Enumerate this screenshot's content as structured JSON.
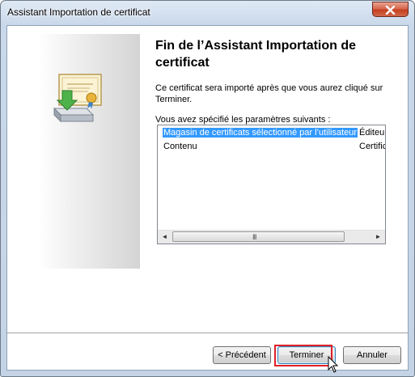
{
  "window": {
    "title": "Assistant Importation de certificat",
    "close_icon": "close-icon"
  },
  "wizard": {
    "icon": "certificate-import-icon",
    "heading_line1": "Fin de l’Assistant Importation de",
    "heading_line2": "certificat",
    "description_line1": "Ce certificat sera importé après que vous aurez cliqué sur",
    "description_line2": "Terminer.",
    "settings_label": "Vous avez spécifié les paramètres suivants :",
    "settings_rows": [
      {
        "name": "Magasin de certificats sélectionné par l’utilisateur",
        "value": "Éditeur",
        "selected": true
      },
      {
        "name": "Contenu",
        "value": "Certific",
        "selected": false
      }
    ],
    "scroll_grip": "III"
  },
  "buttons": {
    "back_label": "< Précédent",
    "finish_label": "Terminer",
    "cancel_label": "Annuler"
  },
  "colors": {
    "selection": "#3399ff",
    "highlight_box": "#e0202a"
  }
}
